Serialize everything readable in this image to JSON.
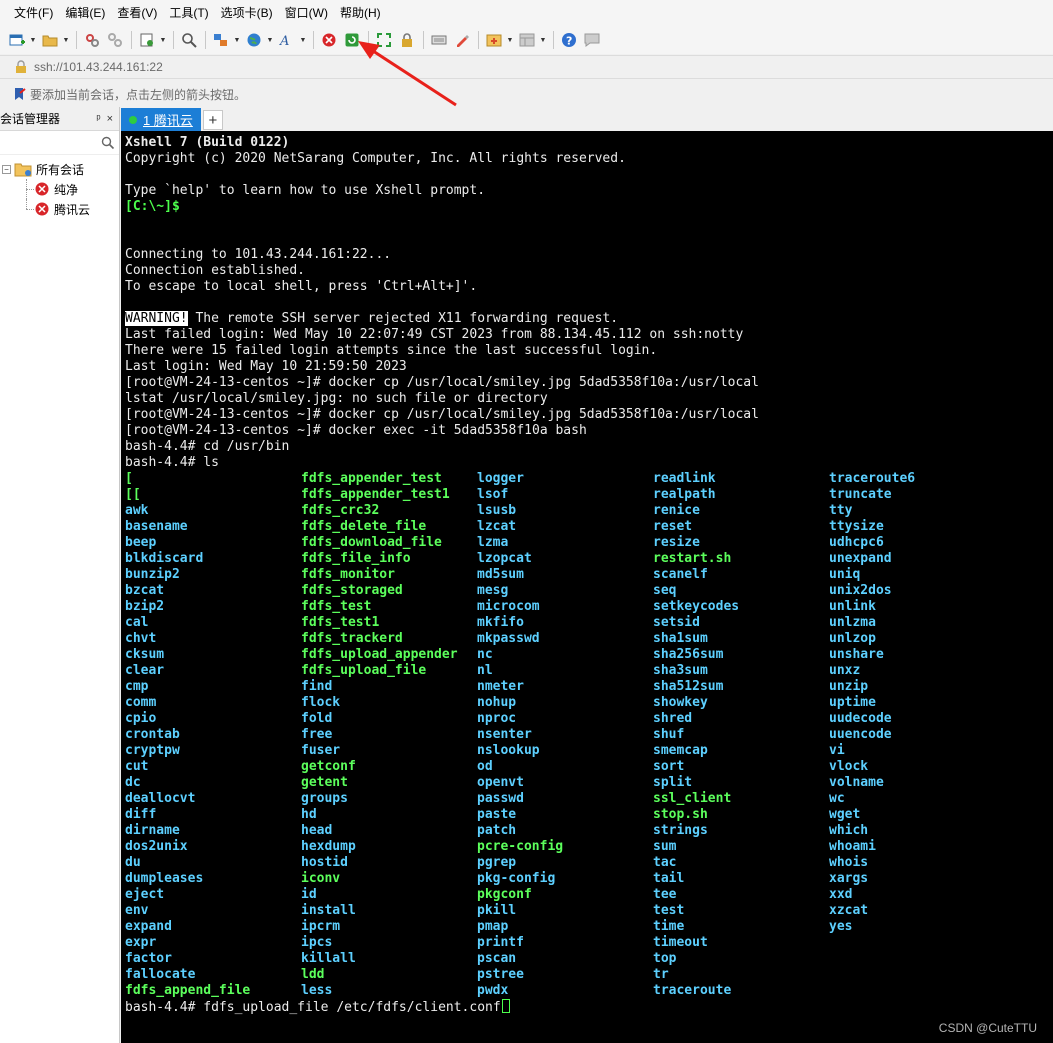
{
  "menu": [
    "文件(F)",
    "编辑(E)",
    "查看(V)",
    "工具(T)",
    "选项卡(B)",
    "窗口(W)",
    "帮助(H)"
  ],
  "address": "ssh://101.43.244.161:22",
  "hint": "要添加当前会话，点击左侧的箭头按钮。",
  "session_manager": {
    "title": "会话管理器",
    "pin": "ᵖ",
    "close": "×",
    "root": "所有会话",
    "children": [
      "纯净",
      "腾讯云"
    ]
  },
  "tab": {
    "label": "1 腾讯云",
    "add": "+"
  },
  "terminal": {
    "l1": "Xshell 7 (Build 0122)",
    "l2": "Copyright (c) 2020 NetSarang Computer, Inc. All rights reserved.",
    "l3": "Type `help' to learn how to use Xshell prompt.",
    "l4": "[C:\\~]$",
    "l5": "Connecting to 101.43.244.161:22...",
    "l6": "Connection established.",
    "l7": "To escape to local shell, press 'Ctrl+Alt+]'.",
    "warn_tag": "WARNING!",
    "warn_rest": " The remote SSH server rejected X11 forwarding request.",
    "l9": "Last failed login: Wed May 10 22:07:49 CST 2023 from 88.134.45.112 on ssh:notty",
    "l10": "There were 15 failed login attempts since the last successful login.",
    "l11": "Last login: Wed May 10 21:59:50 2023",
    "l12": "[root@VM-24-13-centos ~]# docker cp /usr/local/smiley.jpg 5dad5358f10a:/usr/local",
    "l13": "lstat /usr/local/smiley.jpg: no such file or directory",
    "l14": "[root@VM-24-13-centos ~]# docker cp /usr/local/smiley.jpg 5dad5358f10a:/usr/local",
    "l15": "[root@VM-24-13-centos ~]# docker exec -it 5dad5358f10a bash",
    "l16": "bash-4.4# cd /usr/bin",
    "l17": "bash-4.4# ls",
    "last": "bash-4.4# fdfs_upload_file /etc/fdfs/client.conf"
  },
  "ls_columns": [
    [
      {
        "t": "[",
        "c": "g"
      },
      {
        "t": "[[",
        "c": "g"
      },
      {
        "t": "awk",
        "c": "b"
      },
      {
        "t": "basename",
        "c": "b"
      },
      {
        "t": "beep",
        "c": "b"
      },
      {
        "t": "blkdiscard",
        "c": "b"
      },
      {
        "t": "bunzip2",
        "c": "b"
      },
      {
        "t": "bzcat",
        "c": "b"
      },
      {
        "t": "bzip2",
        "c": "b"
      },
      {
        "t": "cal",
        "c": "b"
      },
      {
        "t": "chvt",
        "c": "b"
      },
      {
        "t": "cksum",
        "c": "b"
      },
      {
        "t": "clear",
        "c": "b"
      },
      {
        "t": "cmp",
        "c": "b"
      },
      {
        "t": "comm",
        "c": "b"
      },
      {
        "t": "cpio",
        "c": "b"
      },
      {
        "t": "crontab",
        "c": "b"
      },
      {
        "t": "cryptpw",
        "c": "b"
      },
      {
        "t": "cut",
        "c": "b"
      },
      {
        "t": "dc",
        "c": "b"
      },
      {
        "t": "deallocvt",
        "c": "b"
      },
      {
        "t": "diff",
        "c": "b"
      },
      {
        "t": "dirname",
        "c": "b"
      },
      {
        "t": "dos2unix",
        "c": "b"
      },
      {
        "t": "du",
        "c": "b"
      },
      {
        "t": "dumpleases",
        "c": "b"
      },
      {
        "t": "eject",
        "c": "b"
      },
      {
        "t": "env",
        "c": "b"
      },
      {
        "t": "expand",
        "c": "b"
      },
      {
        "t": "expr",
        "c": "b"
      },
      {
        "t": "factor",
        "c": "b"
      },
      {
        "t": "fallocate",
        "c": "b"
      },
      {
        "t": "fdfs_append_file",
        "c": "g"
      }
    ],
    [
      {
        "t": "fdfs_appender_test",
        "c": "g"
      },
      {
        "t": "fdfs_appender_test1",
        "c": "g"
      },
      {
        "t": "fdfs_crc32",
        "c": "g"
      },
      {
        "t": "fdfs_delete_file",
        "c": "g"
      },
      {
        "t": "fdfs_download_file",
        "c": "g"
      },
      {
        "t": "fdfs_file_info",
        "c": "g"
      },
      {
        "t": "fdfs_monitor",
        "c": "g"
      },
      {
        "t": "fdfs_storaged",
        "c": "g"
      },
      {
        "t": "fdfs_test",
        "c": "g"
      },
      {
        "t": "fdfs_test1",
        "c": "g"
      },
      {
        "t": "fdfs_trackerd",
        "c": "g"
      },
      {
        "t": "fdfs_upload_appender",
        "c": "g"
      },
      {
        "t": "fdfs_upload_file",
        "c": "g"
      },
      {
        "t": "find",
        "c": "b"
      },
      {
        "t": "flock",
        "c": "b"
      },
      {
        "t": "fold",
        "c": "b"
      },
      {
        "t": "free",
        "c": "b"
      },
      {
        "t": "fuser",
        "c": "b"
      },
      {
        "t": "getconf",
        "c": "g"
      },
      {
        "t": "getent",
        "c": "g"
      },
      {
        "t": "groups",
        "c": "b"
      },
      {
        "t": "hd",
        "c": "b"
      },
      {
        "t": "head",
        "c": "b"
      },
      {
        "t": "hexdump",
        "c": "b"
      },
      {
        "t": "hostid",
        "c": "b"
      },
      {
        "t": "iconv",
        "c": "g"
      },
      {
        "t": "id",
        "c": "b"
      },
      {
        "t": "install",
        "c": "b"
      },
      {
        "t": "ipcrm",
        "c": "b"
      },
      {
        "t": "ipcs",
        "c": "b"
      },
      {
        "t": "killall",
        "c": "b"
      },
      {
        "t": "ldd",
        "c": "g"
      },
      {
        "t": "less",
        "c": "b"
      }
    ],
    [
      {
        "t": "logger",
        "c": "b"
      },
      {
        "t": "lsof",
        "c": "b"
      },
      {
        "t": "lsusb",
        "c": "b"
      },
      {
        "t": "lzcat",
        "c": "b"
      },
      {
        "t": "lzma",
        "c": "b"
      },
      {
        "t": "lzopcat",
        "c": "b"
      },
      {
        "t": "md5sum",
        "c": "b"
      },
      {
        "t": "mesg",
        "c": "b"
      },
      {
        "t": "microcom",
        "c": "b"
      },
      {
        "t": "mkfifo",
        "c": "b"
      },
      {
        "t": "mkpasswd",
        "c": "b"
      },
      {
        "t": "nc",
        "c": "b"
      },
      {
        "t": "nl",
        "c": "b"
      },
      {
        "t": "nmeter",
        "c": "b"
      },
      {
        "t": "nohup",
        "c": "b"
      },
      {
        "t": "nproc",
        "c": "b"
      },
      {
        "t": "nsenter",
        "c": "b"
      },
      {
        "t": "nslookup",
        "c": "b"
      },
      {
        "t": "od",
        "c": "b"
      },
      {
        "t": "openvt",
        "c": "b"
      },
      {
        "t": "passwd",
        "c": "b"
      },
      {
        "t": "paste",
        "c": "b"
      },
      {
        "t": "patch",
        "c": "b"
      },
      {
        "t": "pcre-config",
        "c": "g"
      },
      {
        "t": "pgrep",
        "c": "b"
      },
      {
        "t": "pkg-config",
        "c": "b"
      },
      {
        "t": "pkgconf",
        "c": "g"
      },
      {
        "t": "pkill",
        "c": "b"
      },
      {
        "t": "pmap",
        "c": "b"
      },
      {
        "t": "printf",
        "c": "b"
      },
      {
        "t": "pscan",
        "c": "b"
      },
      {
        "t": "pstree",
        "c": "b"
      },
      {
        "t": "pwdx",
        "c": "b"
      }
    ],
    [
      {
        "t": "readlink",
        "c": "b"
      },
      {
        "t": "realpath",
        "c": "b"
      },
      {
        "t": "renice",
        "c": "b"
      },
      {
        "t": "reset",
        "c": "b"
      },
      {
        "t": "resize",
        "c": "b"
      },
      {
        "t": "restart.sh",
        "c": "g"
      },
      {
        "t": "scanelf",
        "c": "b"
      },
      {
        "t": "seq",
        "c": "b"
      },
      {
        "t": "setkeycodes",
        "c": "b"
      },
      {
        "t": "setsid",
        "c": "b"
      },
      {
        "t": "sha1sum",
        "c": "b"
      },
      {
        "t": "sha256sum",
        "c": "b"
      },
      {
        "t": "sha3sum",
        "c": "b"
      },
      {
        "t": "sha512sum",
        "c": "b"
      },
      {
        "t": "showkey",
        "c": "b"
      },
      {
        "t": "shred",
        "c": "b"
      },
      {
        "t": "shuf",
        "c": "b"
      },
      {
        "t": "smemcap",
        "c": "b"
      },
      {
        "t": "sort",
        "c": "b"
      },
      {
        "t": "split",
        "c": "b"
      },
      {
        "t": "ssl_client",
        "c": "g"
      },
      {
        "t": "stop.sh",
        "c": "g"
      },
      {
        "t": "strings",
        "c": "b"
      },
      {
        "t": "sum",
        "c": "b"
      },
      {
        "t": "tac",
        "c": "b"
      },
      {
        "t": "tail",
        "c": "b"
      },
      {
        "t": "tee",
        "c": "b"
      },
      {
        "t": "test",
        "c": "b"
      },
      {
        "t": "time",
        "c": "b"
      },
      {
        "t": "timeout",
        "c": "b"
      },
      {
        "t": "top",
        "c": "b"
      },
      {
        "t": "tr",
        "c": "b"
      },
      {
        "t": "traceroute",
        "c": "b"
      }
    ],
    [
      {
        "t": "traceroute6",
        "c": "b"
      },
      {
        "t": "truncate",
        "c": "b"
      },
      {
        "t": "tty",
        "c": "b"
      },
      {
        "t": "ttysize",
        "c": "b"
      },
      {
        "t": "udhcpc6",
        "c": "b"
      },
      {
        "t": "unexpand",
        "c": "b"
      },
      {
        "t": "uniq",
        "c": "b"
      },
      {
        "t": "unix2dos",
        "c": "b"
      },
      {
        "t": "unlink",
        "c": "b"
      },
      {
        "t": "unlzma",
        "c": "b"
      },
      {
        "t": "unlzop",
        "c": "b"
      },
      {
        "t": "unshare",
        "c": "b"
      },
      {
        "t": "unxz",
        "c": "b"
      },
      {
        "t": "unzip",
        "c": "b"
      },
      {
        "t": "uptime",
        "c": "b"
      },
      {
        "t": "uudecode",
        "c": "b"
      },
      {
        "t": "uuencode",
        "c": "b"
      },
      {
        "t": "vi",
        "c": "b"
      },
      {
        "t": "vlock",
        "c": "b"
      },
      {
        "t": "volname",
        "c": "b"
      },
      {
        "t": "wc",
        "c": "b"
      },
      {
        "t": "wget",
        "c": "b"
      },
      {
        "t": "which",
        "c": "b"
      },
      {
        "t": "whoami",
        "c": "b"
      },
      {
        "t": "whois",
        "c": "b"
      },
      {
        "t": "xargs",
        "c": "b"
      },
      {
        "t": "xxd",
        "c": "b"
      },
      {
        "t": "xzcat",
        "c": "b"
      },
      {
        "t": "yes",
        "c": "b"
      }
    ]
  ],
  "watermark": "CSDN @CuteTTU",
  "colors": {
    "tab_active": "#1c7ed6",
    "ls_blue": "#5dd0ff",
    "ls_green": "#5cff5c",
    "prompt_green": "#4cff4c",
    "annotation_red": "#e8211b"
  },
  "toolbar_icons": [
    "new-session-icon",
    "open-folder-icon",
    "reconnect-icon",
    "disconnect-icon",
    "properties-icon",
    "search-icon",
    "transfer-icon",
    "globe-icon",
    "font-icon",
    "xshell-red-icon",
    "xftp-green-icon",
    "fullscreen-icon",
    "lock-icon",
    "keyboard-icon",
    "highlight-icon",
    "add-tab-icon",
    "layout-icon",
    "help-icon",
    "chat-icon"
  ]
}
